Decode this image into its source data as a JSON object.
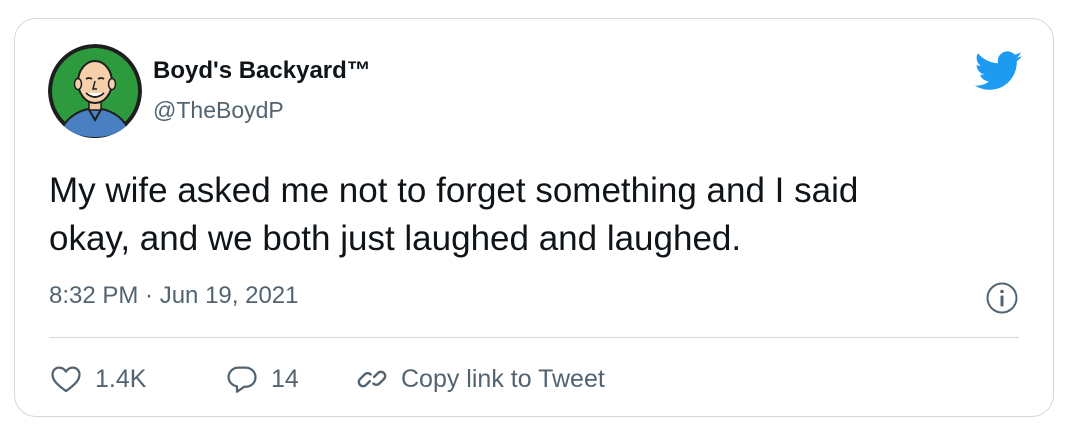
{
  "tweet": {
    "author_name": "Boyd's Backyard™",
    "author_handle": "@TheBoydP",
    "text_lines": [
      "My wife asked me not to forget something and I said",
      "okay, and we both just laughed and laughed."
    ],
    "timestamp": "8:32 PM · Jun 19, 2021"
  },
  "actions": {
    "like_count": "1.4K",
    "reply_count": "14",
    "copy_link_label": "Copy link to Tweet"
  },
  "icons": {
    "brand": "twitter-bird-icon",
    "info": "info-icon",
    "like": "heart-icon",
    "reply": "speech-bubble-icon",
    "link": "link-icon"
  },
  "colors": {
    "brand_blue": "#1d9bf0",
    "text_primary": "#0f1419",
    "text_secondary": "#536471",
    "border": "#cfd9de",
    "avatar_bg": "#2e9a3e"
  }
}
